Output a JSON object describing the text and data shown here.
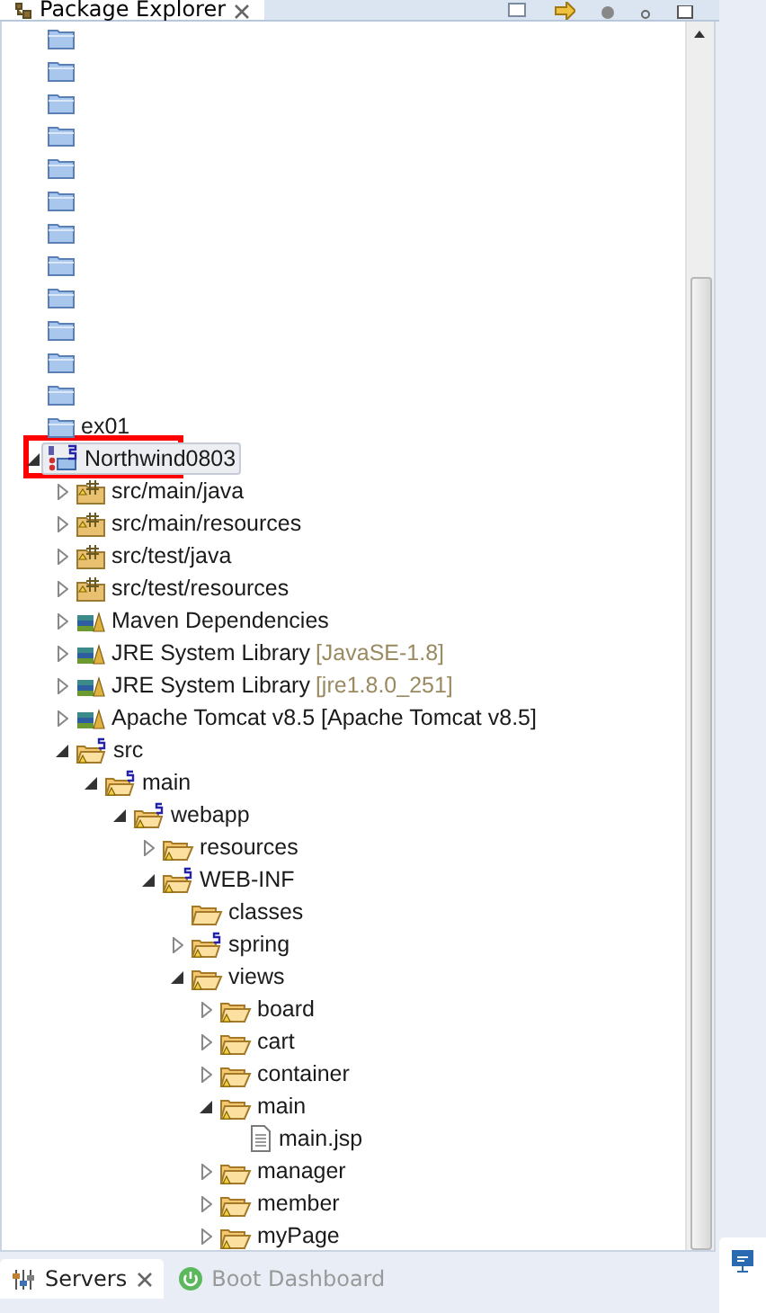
{
  "view": {
    "title": "Package Explorer"
  },
  "tree": [
    {
      "kind": "project-closed",
      "selected": false
    },
    {
      "kind": "project-closed",
      "selected": false
    },
    {
      "kind": "project-closed",
      "selected": false
    },
    {
      "kind": "project-closed",
      "selected": false
    },
    {
      "kind": "project-closed",
      "selected": false
    },
    {
      "kind": "project-closed",
      "selected": false
    },
    {
      "kind": "project-closed",
      "selected": false
    },
    {
      "kind": "project-closed",
      "selected": false
    },
    {
      "kind": "project-closed",
      "selected": false
    },
    {
      "kind": "project-closed",
      "selected": false
    },
    {
      "kind": "project-closed",
      "selected": false
    },
    {
      "kind": "project-closed",
      "selected": false
    },
    {
      "label": "ex01",
      "kind": "project-closed",
      "selected": false
    },
    {
      "label": "Northwind0803",
      "kind": "project",
      "selected": true,
      "expanded": true,
      "children": [
        {
          "label": "src/main/java",
          "kind": "source-folder",
          "selected": false,
          "expanded": false
        },
        {
          "label": "src/main/resources",
          "kind": "source-folder",
          "selected": false,
          "expanded": false
        },
        {
          "label": "src/test/java",
          "kind": "source-folder",
          "selected": false,
          "expanded": false
        },
        {
          "label": "src/test/resources",
          "kind": "source-folder",
          "selected": false,
          "expanded": false
        },
        {
          "label": "Maven Dependencies",
          "kind": "library",
          "selected": false,
          "expanded": false
        },
        {
          "label": "JRE System Library",
          "decoration": "[JavaSE-1.8]",
          "kind": "library",
          "selected": false,
          "expanded": false
        },
        {
          "label": "JRE System Library",
          "decoration": "[jre1.8.0_251]",
          "kind": "library",
          "selected": false,
          "expanded": false
        },
        {
          "label": "Apache Tomcat v8.5 [Apache Tomcat v8.5]",
          "kind": "library",
          "selected": false,
          "expanded": false
        },
        {
          "label": "src",
          "kind": "spring-folder",
          "selected": false,
          "expanded": true,
          "children": [
            {
              "label": "main",
              "kind": "spring-folder",
              "selected": false,
              "expanded": true,
              "children": [
                {
                  "label": "webapp",
                  "kind": "spring-folder",
                  "selected": false,
                  "expanded": true,
                  "children": [
                    {
                      "label": "resources",
                      "kind": "folder",
                      "selected": false,
                      "expanded": false
                    },
                    {
                      "label": "WEB-INF",
                      "kind": "spring-folder",
                      "selected": false,
                      "expanded": true,
                      "children": [
                        {
                          "label": "classes",
                          "kind": "folder-plain",
                          "selected": false
                        },
                        {
                          "label": "spring",
                          "kind": "spring-folder",
                          "selected": false,
                          "expanded": false
                        },
                        {
                          "label": "views",
                          "kind": "folder",
                          "selected": false,
                          "expanded": true,
                          "children": [
                            {
                              "label": "board",
                              "kind": "folder",
                              "selected": false,
                              "expanded": false
                            },
                            {
                              "label": "cart",
                              "kind": "folder",
                              "selected": false,
                              "expanded": false
                            },
                            {
                              "label": "container",
                              "kind": "folder",
                              "selected": false,
                              "expanded": false
                            },
                            {
                              "label": "main",
                              "kind": "folder",
                              "selected": false,
                              "expanded": true,
                              "children": [
                                {
                                  "label": "main.jsp",
                                  "kind": "file",
                                  "selected": false
                                }
                              ]
                            },
                            {
                              "label": "manager",
                              "kind": "folder",
                              "selected": false,
                              "expanded": false
                            },
                            {
                              "label": "member",
                              "kind": "folder",
                              "selected": false,
                              "expanded": false
                            },
                            {
                              "label": "myPage",
                              "kind": "folder",
                              "selected": false,
                              "expanded": false
                            }
                          ]
                        }
                      ]
                    }
                  ]
                }
              ]
            }
          ]
        }
      ]
    }
  ],
  "highlight": {
    "kind": "rectangle",
    "color": "#ff0000"
  },
  "bottom_tabs": [
    {
      "label": "Servers",
      "selected": true,
      "kind": "servers"
    },
    {
      "label": "Boot Dashboard",
      "selected": false,
      "kind": "power"
    }
  ]
}
